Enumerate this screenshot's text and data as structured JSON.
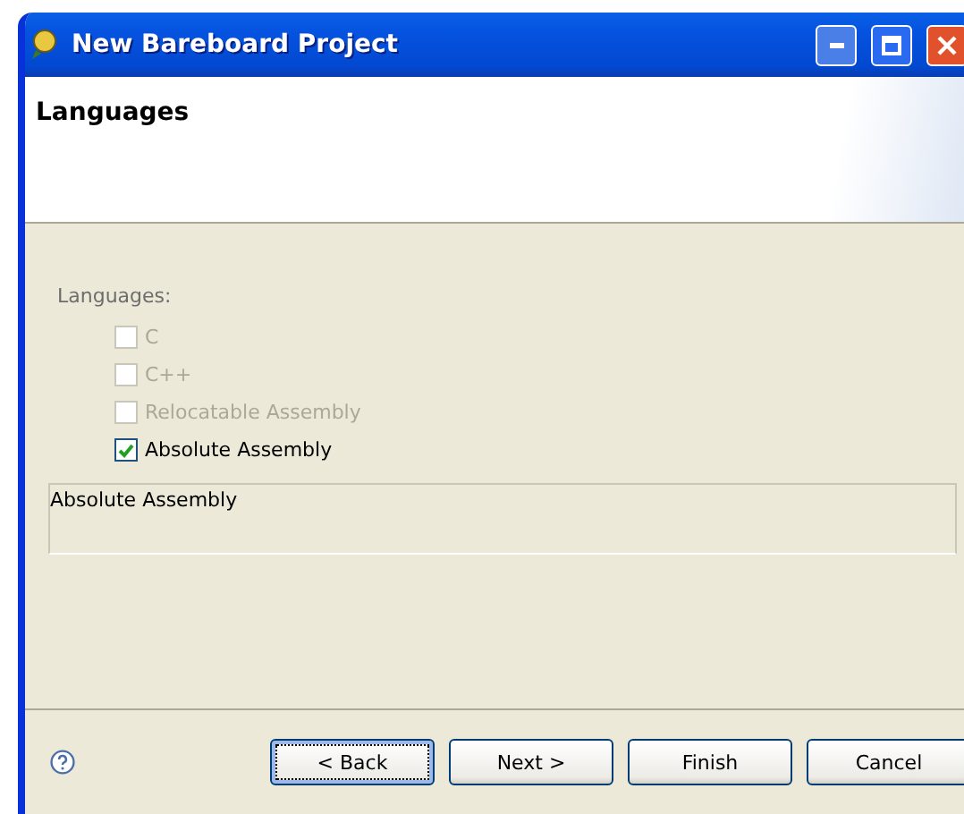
{
  "window": {
    "title": "New Bareboard Project"
  },
  "header": {
    "title": "Languages"
  },
  "languages": {
    "label": "Languages:",
    "options": [
      {
        "label": "C",
        "checked": false,
        "disabled": true
      },
      {
        "label": "C++",
        "checked": false,
        "disabled": true
      },
      {
        "label": "Relocatable Assembly",
        "checked": false,
        "disabled": true
      },
      {
        "label": "Absolute Assembly",
        "checked": true,
        "disabled": false
      }
    ]
  },
  "description": "Absolute Assembly",
  "buttons": [
    {
      "label": "< Back",
      "focused": true
    },
    {
      "label": "Next >",
      "focused": false
    },
    {
      "label": "Finish",
      "focused": false
    },
    {
      "label": "Cancel",
      "focused": false
    }
  ]
}
